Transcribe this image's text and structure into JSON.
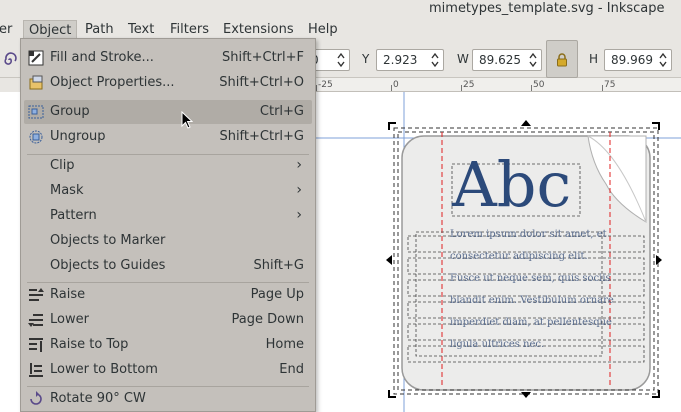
{
  "window": {
    "title": "mimetypes_template.svg - Inkscape"
  },
  "menubar": {
    "items": [
      {
        "id": "layer",
        "label": "er"
      },
      {
        "id": "object",
        "label": "Object",
        "active": true
      },
      {
        "id": "path",
        "label": "Path"
      },
      {
        "id": "text",
        "label": "Text"
      },
      {
        "id": "filters",
        "label": "Filters"
      },
      {
        "id": "extensions",
        "label": "Extensions"
      },
      {
        "id": "help",
        "label": "Help"
      }
    ]
  },
  "toolbar": {
    "x_value": "0",
    "y_label": "Y",
    "y_value": "2.923",
    "w_label": "W",
    "w_value": "89.625",
    "h_label": "H",
    "h_value": "89.969"
  },
  "ruler": {
    "ticks": [
      "-25",
      "0",
      "25",
      "50",
      "75"
    ]
  },
  "object_menu": {
    "items": [
      {
        "label": "Fill and Stroke...",
        "accel": "Shift+Ctrl+F",
        "icon": "fill-stroke-icon"
      },
      {
        "label": "Object Properties...",
        "accel": "Shift+Ctrl+O",
        "icon": "object-properties-icon"
      },
      {
        "label": "Group",
        "accel": "Ctrl+G",
        "icon": "group-icon",
        "highlighted": true
      },
      {
        "label": "Ungroup",
        "accel": "Shift+Ctrl+G",
        "icon": "ungroup-icon"
      },
      {
        "label": "Clip",
        "submenu": true
      },
      {
        "label": "Mask",
        "submenu": true
      },
      {
        "label": "Pattern",
        "submenu": true
      },
      {
        "label": "Objects to Marker"
      },
      {
        "label": "Objects to Guides",
        "accel": "Shift+G"
      },
      {
        "label": "Raise",
        "accel": "Page Up",
        "icon": "raise-icon"
      },
      {
        "label": "Lower",
        "accel": "Page Down",
        "icon": "lower-icon"
      },
      {
        "label": "Raise to Top",
        "accel": "Home",
        "icon": "raise-to-top-icon"
      },
      {
        "label": "Lower to Bottom",
        "accel": "End",
        "icon": "lower-to-bottom-icon"
      },
      {
        "label": "Rotate 90° CW",
        "icon": "rotate-cw-icon"
      }
    ]
  },
  "canvas": {
    "doc_heading": "Abc",
    "doc_lines": [
      "Lorem ipsum dolor sit amet, et",
      "consectetur adipiscing elit.",
      "Fusce ut neque sem, quis sociis",
      "blandit enim. Vestibulum ornare",
      "imperdiet diam, at pellentesque",
      "ligula ultrices nec."
    ]
  },
  "colors": {
    "menu_bg": "#c4c0bb",
    "menu_highlight": "#b0aca6",
    "heading_blue": "#2c4a7a",
    "guide_red": "#e02020"
  }
}
